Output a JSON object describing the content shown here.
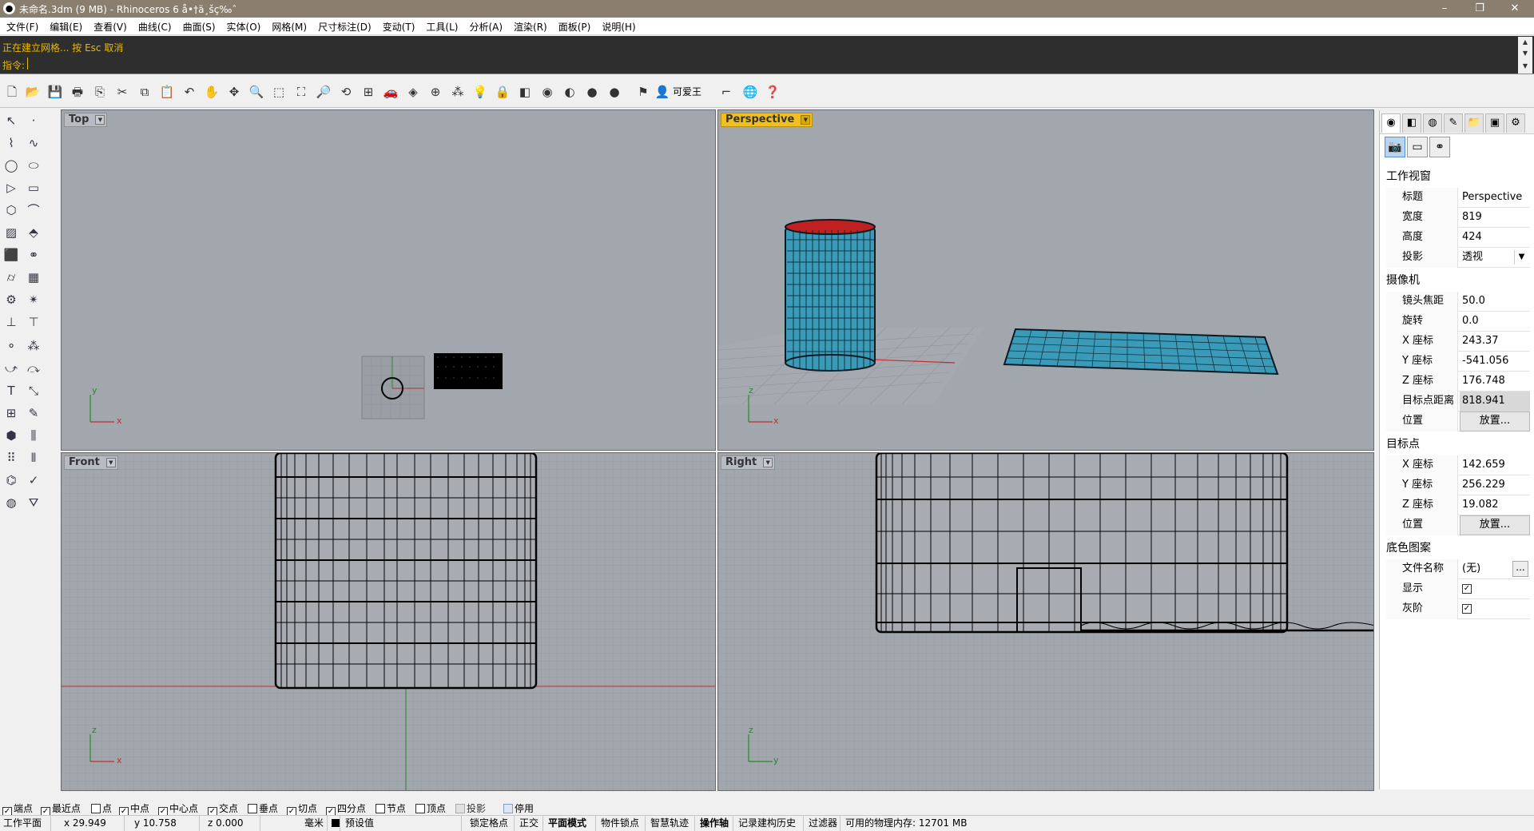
{
  "window": {
    "title": "未命名.3dm (9 MB) - Rhinoceros 6 å•†ä¸šç‰ˆ",
    "controls": {
      "minimize": "–",
      "restore": "❐",
      "close": "✕"
    }
  },
  "menu": [
    "文件(F)",
    "编辑(E)",
    "查看(V)",
    "曲线(C)",
    "曲面(S)",
    "实体(O)",
    "网格(M)",
    "尺寸标注(D)",
    "变动(T)",
    "工具(L)",
    "分析(A)",
    "渲染(R)",
    "面板(P)",
    "说明(H)"
  ],
  "command": {
    "history": "正在建立网格... 按 Esc 取消",
    "prompt": "指令:"
  },
  "toolbar": {
    "user_label": "可爱王"
  },
  "viewports": {
    "top": {
      "label": "Top"
    },
    "perspective": {
      "label": "Perspective"
    },
    "front": {
      "label": "Front"
    },
    "right": {
      "label": "Right"
    }
  },
  "axis_labels": {
    "x": "x",
    "y": "y",
    "z": "z"
  },
  "panel": {
    "section_viewport": "工作视窗",
    "title_key": "标题",
    "title_val": "Perspective",
    "width_key": "宽度",
    "width_val": "819",
    "height_key": "高度",
    "height_val": "424",
    "projection_key": "投影",
    "projection_val": "透视",
    "section_camera": "摄像机",
    "lens_key": "镜头焦距",
    "lens_val": "50.0",
    "rotation_key": "旋转",
    "rotation_val": "0.0",
    "cx_key": "X 座标",
    "cx_val": "243.37",
    "cy_key": "Y 座标",
    "cy_val": "-541.056",
    "cz_key": "Z 座标",
    "cz_val": "176.748",
    "dist_key": "目标点距离",
    "dist_val": "818.941",
    "cam_pos_key": "位置",
    "cam_pos_btn": "放置...",
    "section_target": "目标点",
    "tx_key": "X 座标",
    "tx_val": "142.659",
    "ty_key": "Y 座标",
    "ty_val": "256.229",
    "tz_key": "Z 座标",
    "tz_val": "19.082",
    "target_pos_key": "位置",
    "target_pos_btn": "放置...",
    "section_wallpaper": "底色图案",
    "file_key": "文件名称",
    "file_val": "(无)",
    "show_key": "显示",
    "gray_key": "灰阶"
  },
  "osnaps": [
    {
      "label": "端点",
      "checked": true
    },
    {
      "label": "最近点",
      "checked": true
    },
    {
      "label": "点",
      "checked": false
    },
    {
      "label": "中点",
      "checked": true
    },
    {
      "label": "中心点",
      "checked": true
    },
    {
      "label": "交点",
      "checked": true
    },
    {
      "label": "垂点",
      "checked": false
    },
    {
      "label": "切点",
      "checked": true
    },
    {
      "label": "四分点",
      "checked": true
    },
    {
      "label": "节点",
      "checked": false
    },
    {
      "label": "顶点",
      "checked": false
    },
    {
      "label": "投影",
      "checked": false
    },
    {
      "label": "停用",
      "checked": false
    }
  ],
  "status": {
    "cplane": "工作平面",
    "x": "x 29.949",
    "y": "y 10.758",
    "z": "z 0.000",
    "units": "毫米",
    "layer": "预设值",
    "grid_snap": "锁定格点",
    "ortho": "正交",
    "planar": "平面模式",
    "osnap": "物件锁点",
    "smarttrack": "智慧轨迹",
    "gumball": "操作轴",
    "history": "记录建构历史",
    "filter": "过滤器",
    "memory": "可用的物理内存: 12701 MB"
  }
}
